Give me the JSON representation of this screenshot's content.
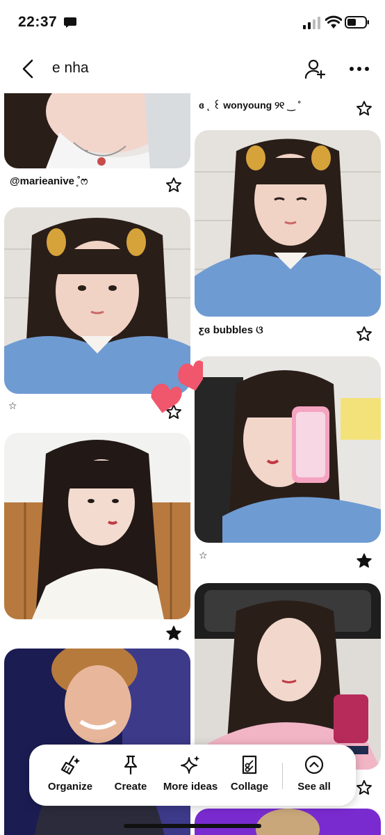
{
  "status_bar": {
    "time": "22:37"
  },
  "header": {
    "title": "e nha"
  },
  "pins": [
    {
      "id": "pin-1",
      "caption": "@marieanive ̥˚ෆ",
      "saved": false
    },
    {
      "id": "pin-2",
      "caption": "ɞ ˛ ꒰ wonyoung ୨୧ ‿ ˚",
      "saved": false
    },
    {
      "id": "pin-3",
      "caption": "☆",
      "saved": false
    },
    {
      "id": "pin-4",
      "caption": "ƹɞ bubbles ଓ",
      "saved": false
    },
    {
      "id": "pin-5",
      "caption": "",
      "saved": true
    },
    {
      "id": "pin-6",
      "caption": "☆",
      "saved": true
    },
    {
      "id": "pin-7",
      "caption": "",
      "saved": false
    },
    {
      "id": "pin-8",
      "caption": "",
      "saved": false
    }
  ],
  "toolbar": {
    "organize": "Organize",
    "create": "Create",
    "more_ideas": "More ideas",
    "collage": "Collage",
    "see_all": "See all"
  },
  "colors": {
    "shirt_blue": "#6f9bd3",
    "hair": "#2a1e19",
    "heart_pink": "#f0566c",
    "accent_dark": "#111111"
  }
}
